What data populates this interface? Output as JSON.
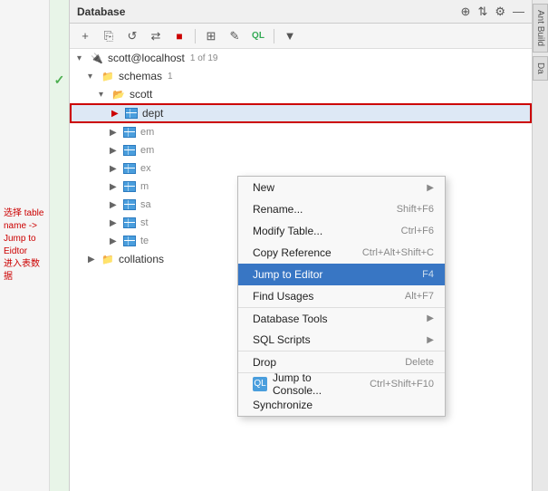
{
  "titleBar": {
    "title": "Database",
    "icons": [
      "+",
      "⊕",
      "⇄",
      "⚙",
      "—"
    ]
  },
  "toolbar": {
    "buttons": [
      "+",
      "⎘",
      "↺",
      "⇄",
      "■",
      "⊞",
      "✎",
      "QL",
      "▼"
    ]
  },
  "tree": {
    "host": "scott@localhost",
    "hostBadge": "1 of 19",
    "schemas": "schemas",
    "schemasBadge": "1",
    "scott": "scott",
    "items": [
      {
        "label": "dept",
        "highlighted": true
      },
      {
        "label": "em"
      },
      {
        "label": "em"
      },
      {
        "label": "ex"
      },
      {
        "label": "m"
      },
      {
        "label": "sa"
      },
      {
        "label": "st"
      },
      {
        "label": "te"
      }
    ],
    "collations": "collations"
  },
  "annotation": {
    "line1": "选择 table name ->",
    "line2": "Jump to Eidtor",
    "line3": "进入表数据"
  },
  "contextMenu": {
    "items": [
      {
        "label": "New",
        "shortcut": "",
        "arrow": "▶",
        "active": false
      },
      {
        "label": "Rename...",
        "shortcut": "Shift+F6",
        "arrow": "",
        "active": false
      },
      {
        "label": "Modify Table...",
        "shortcut": "Ctrl+F6",
        "arrow": "",
        "active": false
      },
      {
        "label": "Copy Reference",
        "shortcut": "Ctrl+Alt+Shift+C",
        "arrow": "",
        "active": false
      },
      {
        "label": "Jump to Editor",
        "shortcut": "F4",
        "arrow": "",
        "active": true
      },
      {
        "label": "Find Usages",
        "shortcut": "Alt+F7",
        "arrow": "",
        "active": false
      },
      {
        "label": "Database Tools",
        "shortcut": "",
        "arrow": "▶",
        "active": false
      },
      {
        "label": "SQL Scripts",
        "shortcut": "",
        "arrow": "▶",
        "active": false
      },
      {
        "label": "Drop",
        "shortcut": "Delete",
        "arrow": "",
        "active": false
      },
      {
        "label": "Jump to Console...",
        "shortcut": "Ctrl+Shift+F10",
        "arrow": "",
        "active": false
      },
      {
        "label": "Synchronize",
        "shortcut": "",
        "arrow": "",
        "active": false
      }
    ]
  },
  "rightSidebar": {
    "tabs": [
      "Ant Build",
      "Da"
    ]
  }
}
